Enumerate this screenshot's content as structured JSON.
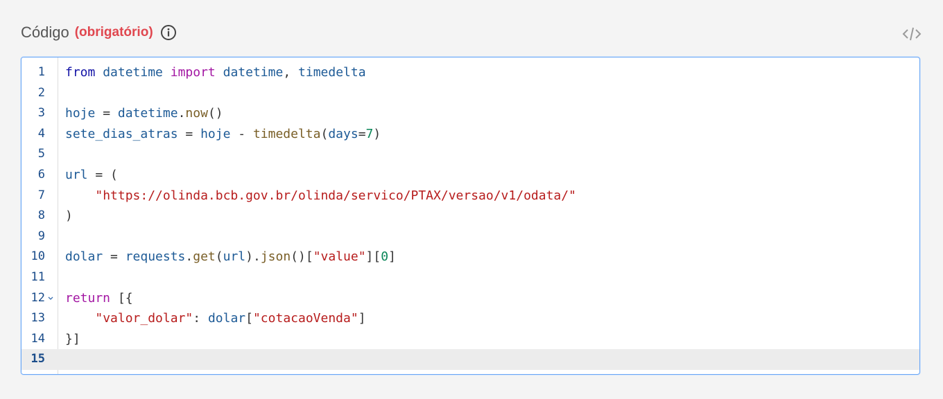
{
  "header": {
    "label": "Código",
    "required": "(obrigatório)",
    "info_icon": "info-icon",
    "toggle_icon": "code-brackets-icon"
  },
  "editor": {
    "active_line": 15,
    "lines": [
      {
        "n": "1",
        "tokens": [
          [
            "kw1",
            "from"
          ],
          [
            "op",
            " "
          ],
          [
            "var",
            "datetime"
          ],
          [
            "op",
            " "
          ],
          [
            "kw2",
            "import"
          ],
          [
            "op",
            " "
          ],
          [
            "var",
            "datetime"
          ],
          [
            "op",
            ", "
          ],
          [
            "var",
            "timedelta"
          ]
        ]
      },
      {
        "n": "2",
        "tokens": []
      },
      {
        "n": "3",
        "tokens": [
          [
            "var",
            "hoje"
          ],
          [
            "op",
            " = "
          ],
          [
            "var",
            "datetime"
          ],
          [
            "op",
            "."
          ],
          [
            "fn",
            "now"
          ],
          [
            "op",
            "()"
          ]
        ]
      },
      {
        "n": "4",
        "tokens": [
          [
            "var",
            "sete_dias_atras"
          ],
          [
            "op",
            " = "
          ],
          [
            "var",
            "hoje"
          ],
          [
            "op",
            " - "
          ],
          [
            "fn",
            "timedelta"
          ],
          [
            "op",
            "("
          ],
          [
            "var",
            "days"
          ],
          [
            "op",
            "="
          ],
          [
            "num",
            "7"
          ],
          [
            "op",
            ")"
          ]
        ]
      },
      {
        "n": "5",
        "tokens": []
      },
      {
        "n": "6",
        "tokens": [
          [
            "var",
            "url"
          ],
          [
            "op",
            " = ("
          ]
        ]
      },
      {
        "n": "7",
        "tokens": [
          [
            "op",
            "    "
          ],
          [
            "str",
            "\"https://olinda.bcb.gov.br/olinda/servico/PTAX/versao/v1/odata/\""
          ]
        ]
      },
      {
        "n": "8",
        "tokens": [
          [
            "op",
            ")"
          ]
        ]
      },
      {
        "n": "9",
        "tokens": []
      },
      {
        "n": "10",
        "tokens": [
          [
            "var",
            "dolar"
          ],
          [
            "op",
            " = "
          ],
          [
            "var",
            "requests"
          ],
          [
            "op",
            "."
          ],
          [
            "fn",
            "get"
          ],
          [
            "op",
            "("
          ],
          [
            "var",
            "url"
          ],
          [
            "op",
            ")."
          ],
          [
            "fn",
            "json"
          ],
          [
            "op",
            "()["
          ],
          [
            "str",
            "\"value\""
          ],
          [
            "op",
            "]["
          ],
          [
            "num",
            "0"
          ],
          [
            "op",
            "]"
          ]
        ]
      },
      {
        "n": "11",
        "tokens": []
      },
      {
        "n": "12",
        "fold": true,
        "tokens": [
          [
            "kw2",
            "return"
          ],
          [
            "op",
            " [{"
          ]
        ]
      },
      {
        "n": "13",
        "tokens": [
          [
            "op",
            "    "
          ],
          [
            "str",
            "\"valor_dolar\""
          ],
          [
            "op",
            ": "
          ],
          [
            "var",
            "dolar"
          ],
          [
            "op",
            "["
          ],
          [
            "str",
            "\"cotacaoVenda\""
          ],
          [
            "op",
            "]"
          ]
        ]
      },
      {
        "n": "14",
        "tokens": [
          [
            "op",
            "}]"
          ]
        ]
      },
      {
        "n": "15",
        "tokens": []
      }
    ]
  },
  "colors": {
    "required": "#e0474f",
    "editor_border": "#69a6f5"
  }
}
